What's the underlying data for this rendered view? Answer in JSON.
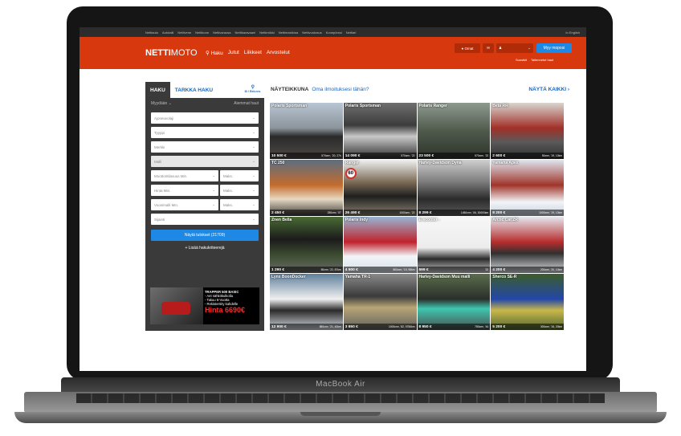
{
  "laptop": {
    "brand": "MacBook Air"
  },
  "topbar": {
    "links": [
      "Nettiauto",
      "Autotalli",
      "Nettivene",
      "Nettikone",
      "Nettivaraosa",
      "Nettikaravaani",
      "Nettimökki",
      "Nettimarkkina",
      "Nettivuokraus",
      "Konepörssi",
      "Nettiari"
    ],
    "lang": "In English"
  },
  "header": {
    "logo_bold": "NETTI",
    "logo_light": "MOTO",
    "nav": [
      "Haku",
      "Jutut",
      "Liikkeet",
      "Arvostelut"
    ],
    "omat": "Omat",
    "sell": "Myy moposi",
    "sub": [
      "Suosikit",
      "Tallennetut haut"
    ],
    "bg_color": "#d7380e"
  },
  "sidebar": {
    "tab_search": "HAKU",
    "tab_advanced": "TARKKA HAKU",
    "tab_id": "ID / Rek.nro.",
    "selling": "Myydään",
    "previous": "Aiemmat haut",
    "fields": [
      "Ajoneuvolaji",
      "Tyyppi",
      "Merkki",
      "Malli"
    ],
    "ranges": [
      {
        "min": "Moottoritilavuus Min.",
        "max": "Maks."
      },
      {
        "min": "Hinta Min.",
        "max": "Maks."
      },
      {
        "min": "Vuosimalli Min.",
        "max": "Maks."
      }
    ],
    "location": "Sijainti",
    "show_button": "Näytä tulokset (21709)",
    "more_criteria": "+ Lisää hakukriteerejä",
    "ad": {
      "title": "TRAPPER 500  BASIC",
      "lines": [
        "- Aet sähkökulkolla",
        "- Takuu 6-Vuotta",
        "- Rekisteröity kahdelle"
      ],
      "price": "Hinta 6690€"
    }
  },
  "showcase": {
    "title": "NÄYTEIKKUNA",
    "subtitle": "Oma ilmoituksesi tähän?",
    "all": "NÄYTÄ KAIKKI",
    "items": [
      {
        "title": "Polaris Sportsman",
        "price": "10 500 €",
        "spec": "570cm³, '20, 27h",
        "bg": "linear-gradient(180deg,#b8c5d2 0%,#8c949b 45%,#2a2a2a 60%,#4e4a44 100%)"
      },
      {
        "title": "Polaris Sportsman",
        "price": "14 090 €",
        "spec": "570cm³, '22",
        "bg": "linear-gradient(180deg,#6f6f6f 0%,#3c3c3c 40%,#c9c9c9 60%,#2b2b2b 100%)"
      },
      {
        "title": "Polaris Ranger",
        "price": "23 500 €",
        "spec": "570cm³, '22",
        "bg": "linear-gradient(180deg,#8f9a8f 0%,#4f5a4c 50%,#2d332b 100%)"
      },
      {
        "title": "Beta RR",
        "price": "2 600 €",
        "spec": "50cm³, '19, 10km",
        "bg": "linear-gradient(180deg,#d8d6d0 0%,#a13028 45%,#5a5a5a 70%,#2d2d2d 100%)"
      },
      {
        "title": "TC 250",
        "price": "2 450 €",
        "spec": "250cm³, '07",
        "bg": "linear-gradient(180deg,#5c6e82 0%,#c46b2c 45%,#e6d9c2 70%,#3a3a3a 100%)"
      },
      {
        "title": "Ranger",
        "price": "26 490 €",
        "spec": "1000cm³, '22",
        "bg": "linear-gradient(180deg,#f1f1f1 0%,#7a6a55 40%,#1f1f1f 65%,#8d8474 100%)",
        "sign": "60"
      },
      {
        "title": "Harley-Davidson Dyna",
        "price": "8 299 €",
        "spec": "1450cm³, '06, 30000km",
        "bg": "linear-gradient(180deg,#cfcfcf 0%,#7a7a7a 40%,#2b2b2b 70%,#5c5c5c 100%)"
      },
      {
        "title": "Yamaha Apex",
        "price": "8 200 €",
        "spec": "1000cm³, '19, 10km",
        "bg": "linear-gradient(180deg,#dfe7f0 0%,#a0352a 45%,#f2f4f7 75%,#c8d2dd 100%)"
      },
      {
        "title": "Znen Bella",
        "price": "1 290 €",
        "spec": "50cm³, '22, 87km",
        "bg": "linear-gradient(180deg,#4a6b34 0%,#1b1b1b 40%,#3f4f33 70%,#6a6a6a 100%)"
      },
      {
        "title": "Polaris Indy",
        "price": "4 500 €",
        "spec": "800cm³, '15, 98km",
        "bg": "linear-gradient(180deg,#97b6d4 0%,#c0222b 45%,#f1f4f8 70%,#d9e1ea 100%)"
      },
      {
        "title": "E-scooter -",
        "price": "599 €",
        "spec": "'22",
        "bg": "linear-gradient(180deg,#f7f7f7 0%,#ececec 55%,#2a2a2a 75%,#d5d5d5 100%)"
      },
      {
        "title": "Arctic Cat ZR",
        "price": "4 200 €",
        "spec": "200cm³, '20, 10km",
        "bg": "linear-gradient(180deg,#e4e8ee 0%,#b72c2c 45%,#303030 65%,#dde2e8 100%)"
      },
      {
        "title": "Lynx BoonDocker",
        "price": "12 900 €",
        "spec": "850cm³, '21, 40km",
        "bg": "linear-gradient(180deg,#5f7f9c 0%,#f0f0f0 45%,#2a2a2a 65%,#d7dde3 100%)"
      },
      {
        "title": "Yamaha TR-1",
        "price": "3 650 €",
        "spec": "1000cm³, '82, 9756km",
        "bg": "linear-gradient(180deg,#8a8a8a 0%,#3a3a3a 40%,#b9a677 60%,#5e5e5e 100%)"
      },
      {
        "title": "Harley-Davidson Muu malli",
        "price": "8 950 €",
        "spec": "750cm³, '44",
        "bg": "linear-gradient(180deg,#5b6d4c 0%,#2a2f2a 45%,#3fc7b0 62%,#4b4b4b 100%)"
      },
      {
        "title": "Sherco SE-R",
        "price": "5 200 €",
        "spec": "300cm³, '16, 20km",
        "bg": "linear-gradient(180deg,#3c5d2a 0%,#2346a8 45%,#c9b84a 65%,#4d6333 100%)"
      }
    ]
  }
}
